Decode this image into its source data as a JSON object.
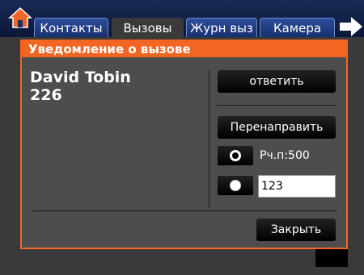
{
  "tabs": [
    {
      "label": "Контакты",
      "active": false
    },
    {
      "label": "Вызовы",
      "active": true
    },
    {
      "label": "Журн выз",
      "active": false
    },
    {
      "label": "Камера",
      "active": false
    }
  ],
  "icons": {
    "home": "home-icon",
    "next": "arrow-right-icon"
  },
  "dialog": {
    "title": "Уведомление о вызове",
    "caller_name": "David Tobin",
    "caller_number": "226",
    "answer_label": "ответить",
    "forward_label": "Перенаправить",
    "option1_label": "Рч.п:500",
    "option1_selected": false,
    "option2_value": "123",
    "option2_selected": true,
    "close_label": "Закрыть"
  },
  "colors": {
    "accent": "#f26522",
    "tabbar": "#16306e",
    "panel": "#4d4d4d"
  }
}
